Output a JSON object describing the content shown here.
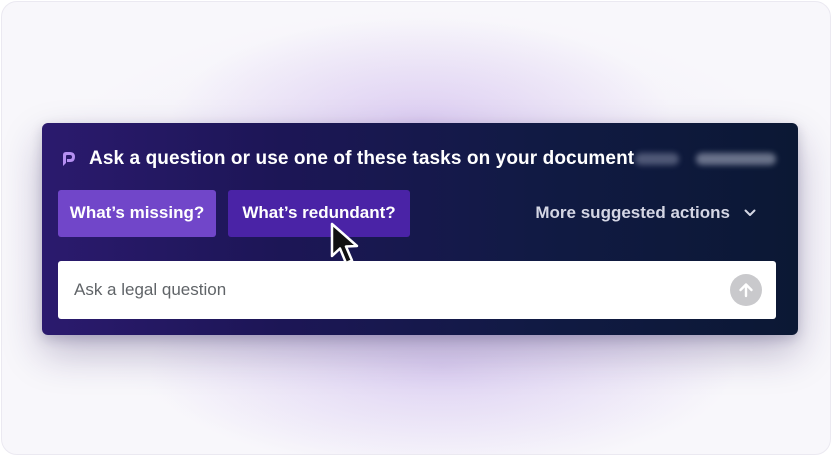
{
  "assistant": {
    "title": "Ask a question or use one of these tasks on your document",
    "logo_icon": "brand-logo-icon",
    "accent_color": "#7146c9"
  },
  "actions": {
    "chips": [
      {
        "label": "What’s missing?",
        "color": "#7146c9"
      },
      {
        "label": "What’s redundant?",
        "color": "#4a23a6"
      }
    ],
    "more_label": "More suggested actions",
    "more_icon": "chevron-down-icon"
  },
  "query": {
    "placeholder": "Ask a legal question",
    "value": "",
    "send_icon": "arrow-up-icon"
  },
  "pointer": {
    "icon": "mouse-pointer-icon"
  }
}
